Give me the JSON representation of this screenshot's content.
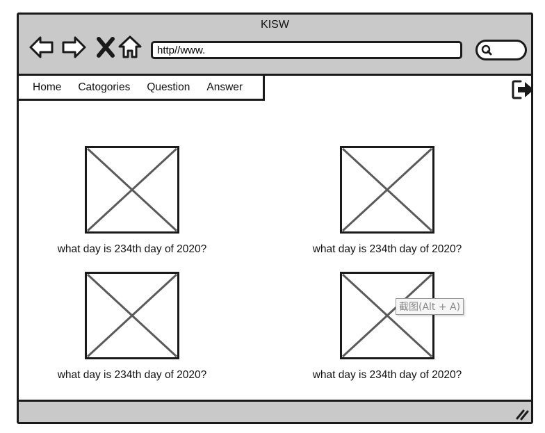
{
  "window": {
    "title": "KISW"
  },
  "toolbar": {
    "icons": [
      "back-arrow-icon",
      "forward-arrow-icon",
      "close-icon",
      "home-icon"
    ],
    "url_value": "http//www.",
    "search_icon": "search-icon"
  },
  "menu": {
    "items": [
      {
        "label": "Home"
      },
      {
        "label": "Catogories"
      },
      {
        "label": "Question"
      },
      {
        "label": "Answer"
      }
    ],
    "logout_icon": "logout-icon"
  },
  "cards": [
    {
      "caption": "what day is 234th day of 2020?",
      "image": "image-placeholder"
    },
    {
      "caption": "what day is 234th day of 2020?",
      "image": "image-placeholder"
    },
    {
      "caption": "what day is 234th day of 2020?",
      "image": "image-placeholder"
    },
    {
      "caption": "what day is 234th day of 2020?",
      "image": "image-placeholder"
    }
  ],
  "tooltip": {
    "text": "截图(Alt + A)"
  },
  "colors": {
    "chrome": "#c9c9c9",
    "outline": "#1a1a1a",
    "placeholder_stroke": "#5a5a5a",
    "tooltip_text": "#8a8a8a"
  }
}
